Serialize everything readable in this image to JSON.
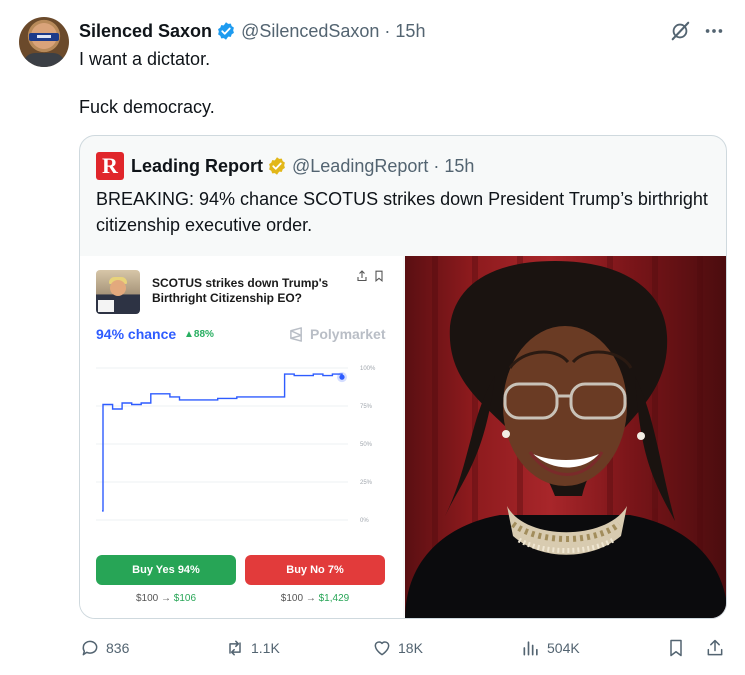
{
  "tweet": {
    "author_name": "Silenced Saxon",
    "handle": "@SilencedSaxon",
    "separator": "·",
    "time": "15h",
    "text_line1": "I want a dictator.",
    "text_line2": "Fuck democracy."
  },
  "quote": {
    "logo_letter": "R",
    "author_name": "Leading Report",
    "handle": "@LeadingReport",
    "separator": "·",
    "time": "15h",
    "text": "BREAKING: 94% chance SCOTUS strikes down President Trump’s birthright citizenship executive order."
  },
  "market_card": {
    "title": "SCOTUS strikes down Trump's Birthright Citizenship EO?",
    "chance": "94% chance",
    "change": "▲88%",
    "brand": "Polymarket",
    "buy_yes": "Buy Yes 94%",
    "buy_no": "Buy No 7%",
    "payout_yes_from": "$100 →",
    "payout_yes_to": "$106",
    "payout_no_from": "$100 →",
    "payout_no_to": "$1,429",
    "colors": {
      "line": "#2e5cff",
      "yes": "#27a556",
      "no": "#e23b3b"
    }
  },
  "chart_data": {
    "type": "line",
    "title": "",
    "xlabel": "",
    "ylabel": "",
    "ylim": [
      0,
      100
    ],
    "y_ticks": [
      "100%",
      "75%",
      "50%",
      "25%",
      "0%"
    ],
    "y_tick_values": [
      100,
      75,
      50,
      25,
      0
    ],
    "grid": true,
    "series": [
      {
        "values": [
          6,
          76,
          73,
          77,
          76,
          77,
          83,
          83,
          81,
          79,
          79,
          79,
          79,
          80,
          80,
          81,
          81,
          81,
          81,
          81,
          96,
          95,
          95,
          96,
          95,
          96,
          94
        ]
      }
    ]
  },
  "actions": {
    "replies": "836",
    "reposts": "1.1K",
    "likes": "18K",
    "views": "504K"
  },
  "icons": [
    "verified-badge-icon",
    "grok-icon",
    "more-icon",
    "gold-verified-badge-icon",
    "share-icon",
    "bookmark-icon",
    "polymarket-logo-icon",
    "reply-icon",
    "repost-icon",
    "like-icon",
    "views-icon",
    "share-upload-icon"
  ],
  "colors": {
    "text": "#0f1419",
    "muted": "#536471",
    "verified": "#1d9bf0",
    "gold": "#e2b719",
    "lr_red": "#e0262b"
  }
}
